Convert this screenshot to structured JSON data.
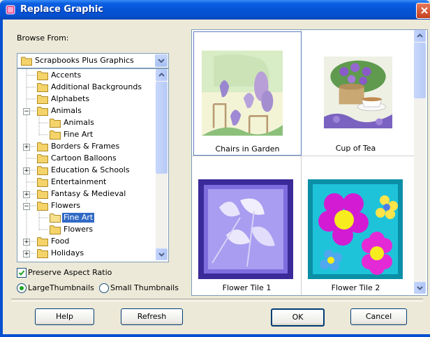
{
  "window": {
    "title": "Replace Graphic",
    "close_icon": "close-x"
  },
  "browse": {
    "label": "Browse From:",
    "selected_source": "Scrapbooks Plus Graphics"
  },
  "tree": {
    "items": [
      {
        "label": "Accents",
        "level": 1,
        "expander": "",
        "selected": false
      },
      {
        "label": "Additional Backgrounds",
        "level": 1,
        "expander": "",
        "selected": false
      },
      {
        "label": "Alphabets",
        "level": 1,
        "expander": "",
        "selected": false
      },
      {
        "label": "Animals",
        "level": 1,
        "expander": "−",
        "selected": false
      },
      {
        "label": "Animals",
        "level": 2,
        "expander": "",
        "selected": false
      },
      {
        "label": "Fine Art",
        "level": 2,
        "expander": "",
        "selected": false
      },
      {
        "label": "Borders & Frames",
        "level": 1,
        "expander": "+",
        "selected": false
      },
      {
        "label": "Cartoon Balloons",
        "level": 1,
        "expander": "",
        "selected": false
      },
      {
        "label": "Education & Schools",
        "level": 1,
        "expander": "+",
        "selected": false
      },
      {
        "label": "Entertainment",
        "level": 1,
        "expander": "",
        "selected": false
      },
      {
        "label": "Fantasy & Medieval",
        "level": 1,
        "expander": "+",
        "selected": false
      },
      {
        "label": "Flowers",
        "level": 1,
        "expander": "−",
        "selected": false
      },
      {
        "label": "Fine Art",
        "level": 2,
        "expander": "",
        "selected": true
      },
      {
        "label": "Flowers",
        "level": 2,
        "expander": "",
        "selected": false
      },
      {
        "label": "Food",
        "level": 1,
        "expander": "+",
        "selected": false
      },
      {
        "label": "Holidays",
        "level": 1,
        "expander": "+",
        "selected": false
      }
    ]
  },
  "options": {
    "preserve_aspect_ratio": "Preserve Aspect Ratio",
    "preserve_checked": true,
    "large_thumbnails": "LargeThumbnails",
    "small_thumbnails": "Small Thumbnails",
    "thumbnail_mode": "large"
  },
  "gallery": {
    "items": [
      {
        "caption": "Chairs in Garden",
        "selected": true
      },
      {
        "caption": "Cup of Tea",
        "selected": false
      },
      {
        "caption": "Flower Tile 1",
        "selected": false
      },
      {
        "caption": "Flower Tile 2",
        "selected": false
      }
    ]
  },
  "buttons": {
    "help": "Help",
    "refresh": "Refresh",
    "ok": "OK",
    "cancel": "Cancel"
  },
  "colors": {
    "title_bar": "#0654d6",
    "selection": "#316ac5",
    "dialog_bg": "#ece9d8"
  }
}
